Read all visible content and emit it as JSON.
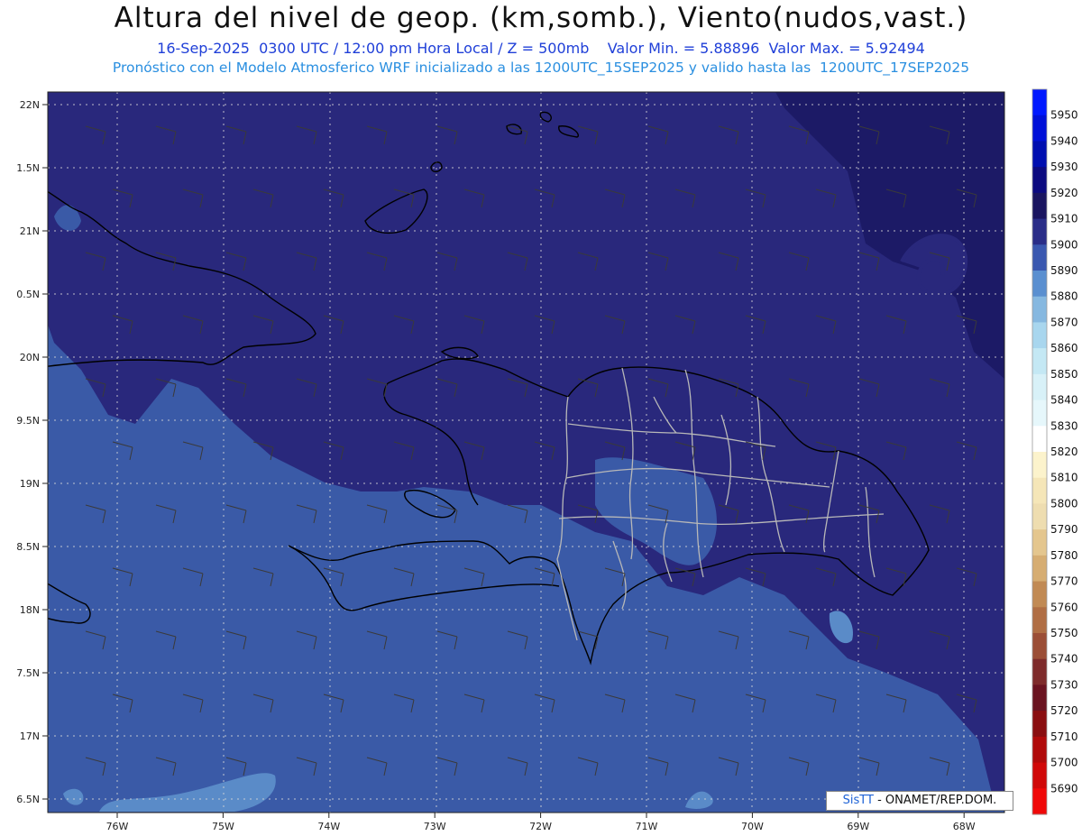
{
  "title": "Altura del nivel de geop. (km,somb.), Viento(nudos,vast.)",
  "subtitle": "16-Sep-2025  0300 UTC / 12:00 pm Hora Local / Z = 500mb    Valor Min. = 5.88896  Valor Max. = 5.92494",
  "subtitle2": "Pronóstico con el Modelo Atmosferico WRF inicializado a las 1200UTC_15SEP2025 y valido hasta las  1200UTC_17SEP2025",
  "credit": {
    "brand": "SisTT",
    "rest": "- ONAMET/REP.DOM."
  },
  "lat_ticks": [
    "22N",
    "1.5N",
    "21N",
    "0.5N",
    "20N",
    "9.5N",
    "19N",
    "8.5N",
    "18N",
    "7.5N",
    "17N",
    "6.5N"
  ],
  "lon_ticks": [
    "76W",
    "75W",
    "74W",
    "73W",
    "72W",
    "71W",
    "70W",
    "69W",
    "68W"
  ],
  "colorbar": {
    "levels": [
      5950,
      5940,
      5930,
      5920,
      5910,
      5900,
      5890,
      5880,
      5870,
      5860,
      5850,
      5840,
      5830,
      5820,
      5810,
      5800,
      5790,
      5780,
      5770,
      5760,
      5750,
      5740,
      5730,
      5720,
      5710,
      5700,
      5690
    ],
    "colors": [
      "#0018ff",
      "#0010d8",
      "#000eb0",
      "#0c0a80",
      "#1a1560",
      "#2a2d88",
      "#3a58b0",
      "#5a8fd0",
      "#86b8e0",
      "#a8d6ee",
      "#c4e8f4",
      "#d8f1f8",
      "#e6f7fb",
      "#ffffff",
      "#fcf3cc",
      "#f5e6b8",
      "#eeddb0",
      "#e4c68e",
      "#d6ad72",
      "#c18a54",
      "#b06e44",
      "#9b4e36",
      "#7e2b2b",
      "#6a1320",
      "#8a0e10",
      "#b00a0a",
      "#d00808",
      "#f00808"
    ]
  },
  "map_colors": {
    "ocean_dark": "#29287c",
    "ocean_mid": "#3a5aa7",
    "ocean_light": "#5a8bc8",
    "coast": "#000000",
    "border": "#b8b8b8"
  }
}
